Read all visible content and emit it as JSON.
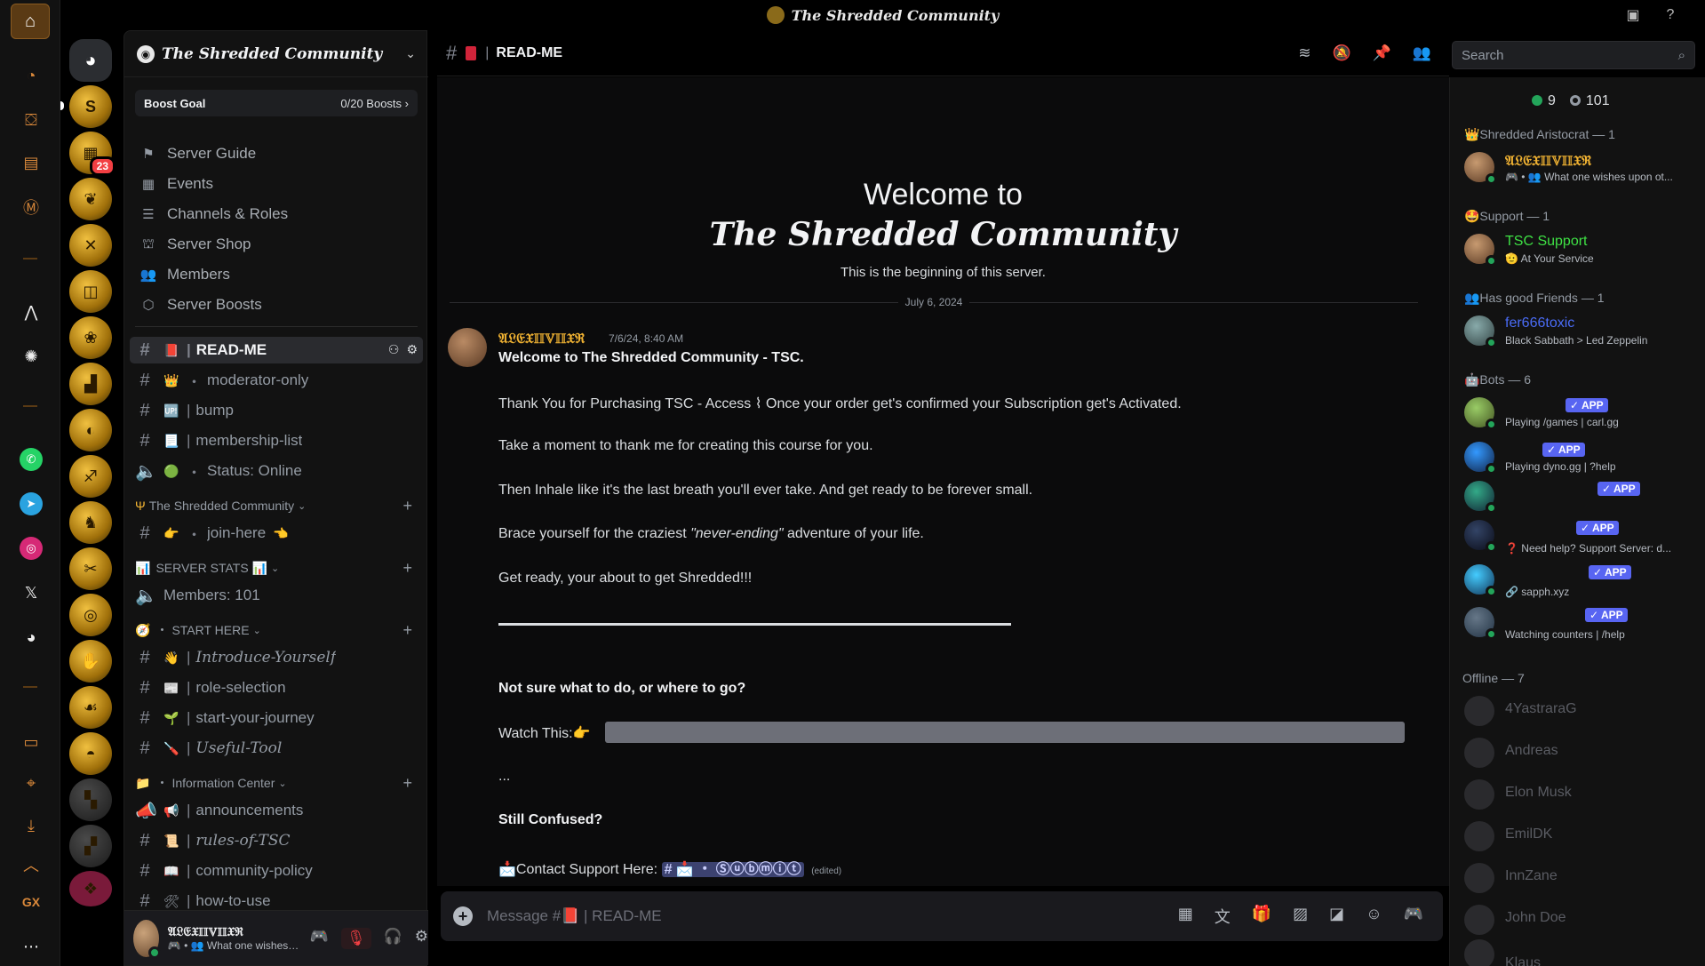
{
  "titlebar": {
    "title": "The Shredded Community"
  },
  "server": {
    "name": "The Shredded Community",
    "boost": {
      "label": "Boost Goal",
      "value": "0/20 Boosts ›"
    },
    "nav": [
      {
        "label": "Server Guide",
        "icon": "signpost-icon"
      },
      {
        "label": "Events",
        "icon": "calendar-icon"
      },
      {
        "label": "Channels & Roles",
        "icon": "list-icon"
      },
      {
        "label": "Server Shop",
        "icon": "shop-icon"
      },
      {
        "label": "Members",
        "icon": "people-icon"
      },
      {
        "label": "Server Boosts",
        "icon": "boost-icon"
      }
    ],
    "server_badge": "23",
    "channels_top": [
      {
        "emoji": "📕",
        "name": "READ-ME",
        "sep": "|",
        "active": true
      },
      {
        "emoji": "👑",
        "name": "moderator-only",
        "sep": "・"
      },
      {
        "emoji": "🆙",
        "name": "bump",
        "sep": "|"
      },
      {
        "emoji": "📃",
        "name": "membership-list",
        "sep": "|"
      },
      {
        "emoji": "🟢",
        "name": "Status: Online",
        "sep": "・",
        "voice": true
      }
    ],
    "cat1": {
      "label": "The Shredded Community",
      "channels": [
        {
          "emoji": "👉",
          "name": "join-here",
          "sep": "・",
          "suffix": "👈"
        }
      ]
    },
    "cat2": {
      "label": "SERVER STATS 📊",
      "channels": [
        {
          "name": "Members: 101",
          "voice": true
        }
      ]
    },
    "cat3": {
      "label": "START HERE",
      "channels": [
        {
          "emoji": "👋",
          "name": "Introduce-Yourself",
          "sep": "|",
          "fancy": true
        },
        {
          "emoji": "📰",
          "name": "role-selection",
          "sep": "|"
        },
        {
          "emoji": "🌱",
          "name": "start-your-journey",
          "sep": "|"
        },
        {
          "emoji": "🪛",
          "name": "Useful-Tool",
          "sep": "|",
          "fancy": true
        }
      ]
    },
    "cat4": {
      "label": "Information Center",
      "channels": [
        {
          "emoji": "📢",
          "name": "announcements",
          "sep": "|",
          "voice": true
        },
        {
          "emoji": "📜",
          "name": "rules-of-TSC",
          "sep": "|"
        },
        {
          "emoji": "📖",
          "name": "community-policy",
          "sep": "|"
        },
        {
          "emoji": "🛠",
          "name": "how-to-use",
          "sep": "|"
        }
      ]
    }
  },
  "user": {
    "name": "𝔄𝔏𝔈𝔛𝕀𝕀𝕍𝕀𝕀𝔛ℜ",
    "status": "🎮 • 👥 What one wishes upo..."
  },
  "channel": {
    "name": "READ-ME",
    "search_placeholder": "Search",
    "composer_placeholder": "Message #📕 | READ-ME"
  },
  "welcome": {
    "line1": "Welcome to",
    "line2": "The Shredded Community",
    "line3": "This is the beginning of this server.",
    "date": "July 6, 2024"
  },
  "message": {
    "author": "𝔄𝔏𝔈𝔛𝕀𝕀𝕍𝕀𝕀𝔛ℜ",
    "timestamp": "7/6/24, 8:40 AM",
    "l1": "Welcome to The Shredded Community - TSC.",
    "l2": "Thank You for Purchasing TSC - Access ⌇ Once your order get's confirmed your Subscription get's Activated.",
    "l3": "Take a moment to thank me for creating this course for you.",
    "l4": "Then Inhale like it's the last breath you'll ever take. And get ready to be forever small.",
    "l5a": "Brace yourself for the craziest ",
    "l5b": "\"never-ending\"",
    "l5c": " adventure of your life.",
    "l6": "Get ready, your about to get Shredded!!!",
    "l7": "Not sure what to do, or where to go?",
    "l8": "Watch This:👉",
    "l9": "...",
    "l10": "Still Confused?",
    "l11": "📩Contact Support Here:",
    "mention": "# 📩 ・ Ⓢⓤⓑⓜⓘⓣ",
    "edited": "(edited)"
  },
  "members": {
    "online": "9",
    "total": "101",
    "g1": "👑Shredded Aristocrat — 1",
    "m1": {
      "name": "𝔄𝔏𝔈𝔛𝕀𝕀𝕍𝕀𝕀𝔛ℜ",
      "sub": "🎮 • 👥 What one wishes upon ot...",
      "color": "#f0b232"
    },
    "g2": "🤩Support — 1",
    "m2": {
      "name": "TSC Support",
      "sub": "🫡 At Your Service",
      "color": "#3ee044"
    },
    "g3": "👥Has good Friends — 1",
    "m3": {
      "name": "fer666toxic",
      "sub": "Black Sabbath > Led Zeppelin",
      "color": "#4a6cf7"
    },
    "g4": "🤖Bots — 6",
    "bots": [
      {
        "sub": "Playing /games | carl.gg",
        "app": "✓ APP"
      },
      {
        "sub": "Playing dyno.gg | ?help",
        "app": "✓ APP"
      },
      {
        "sub": "",
        "app": "✓ APP"
      },
      {
        "sub": "❓ Need help? Support Server: d...",
        "app": "✓ APP"
      },
      {
        "sub": "🔗 sapph.xyz",
        "app": "✓ APP"
      },
      {
        "sub": "Watching counters | /help",
        "app": "✓ APP"
      }
    ],
    "g5": "Offline — 7",
    "offline": [
      "4YastraraG",
      "Andreas",
      "Elon Musk",
      "EmilDK",
      "InnZane",
      "John Doe",
      "Klaus"
    ]
  }
}
